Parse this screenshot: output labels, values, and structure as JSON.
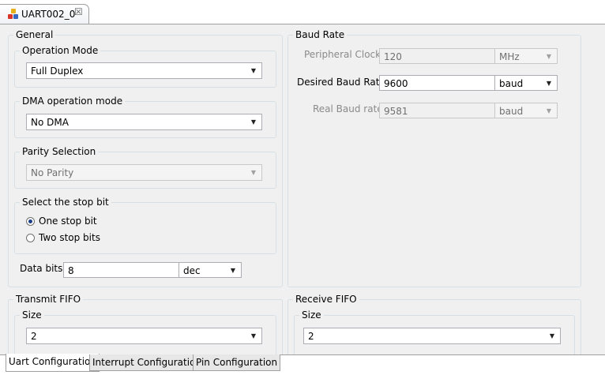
{
  "editor_tab": {
    "title": "UART002_0",
    "close_glyph": "☒"
  },
  "general": {
    "legend": "General",
    "operation_mode": {
      "legend": "Operation Mode",
      "value": "Full Duplex"
    },
    "dma_mode": {
      "legend": "DMA operation mode",
      "value": "No DMA"
    },
    "parity": {
      "legend": "Parity Selection",
      "value": "No Parity"
    },
    "stop_bit": {
      "legend": "Select the stop bit",
      "options": [
        {
          "label": "One stop bit",
          "checked": true
        },
        {
          "label": "Two stop bits",
          "checked": false
        }
      ]
    },
    "data_bits": {
      "label": "Data bits",
      "value": "8",
      "format": "dec"
    }
  },
  "baud_rate": {
    "legend": "Baud Rate",
    "peripheral_clock": {
      "label": "Peripheral Clock",
      "value": "120",
      "unit": "MHz"
    },
    "desired_baud_rate": {
      "label": "Desired Baud Rate",
      "value": "9600",
      "unit": "baud"
    },
    "real_baud_rate": {
      "label": "Real Baud rate",
      "value": "9581",
      "unit": "baud"
    }
  },
  "transmit_fifo": {
    "legend": "Transmit FIFO",
    "size_legend": "Size",
    "size_value": "2"
  },
  "receive_fifo": {
    "legend": "Receive FIFO",
    "size_legend": "Size",
    "size_value": "2"
  },
  "bottom_tabs": [
    {
      "label": "Uart Configuration",
      "active": true
    },
    {
      "label": "Interrupt Configuration",
      "active": false
    },
    {
      "label": "Pin Configuration",
      "active": false
    }
  ],
  "colors": {
    "group_border": "#d5dfe5",
    "panel_bg": "#f0f0f0",
    "radio_dot": "#1a3f8a"
  }
}
